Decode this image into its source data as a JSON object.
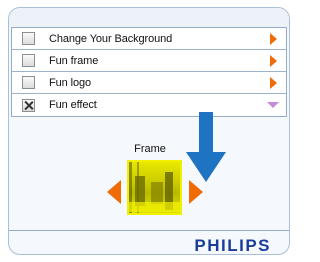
{
  "menu": {
    "items": [
      {
        "label": "Change Your Background",
        "checked": false,
        "indicator": "arrow-right"
      },
      {
        "label": "Fun frame",
        "checked": false,
        "indicator": "arrow-right"
      },
      {
        "label": "Fun logo",
        "checked": false,
        "indicator": "arrow-right"
      },
      {
        "label": "Fun effect",
        "checked": true,
        "indicator": "arrow-down"
      }
    ]
  },
  "effect": {
    "title": "Frame"
  },
  "brand": {
    "logo_text": "PHILIPS"
  },
  "colors": {
    "accent_orange": "#f06a05",
    "annotation_blue": "#1f73c3",
    "brand_blue": "#1a3d9c",
    "expanded_indicator": "#c48ad6"
  },
  "icons": {
    "prev": "orange-left-arrow-icon",
    "next": "orange-right-arrow-icon",
    "pointer": "blue-down-arrow-icon"
  }
}
